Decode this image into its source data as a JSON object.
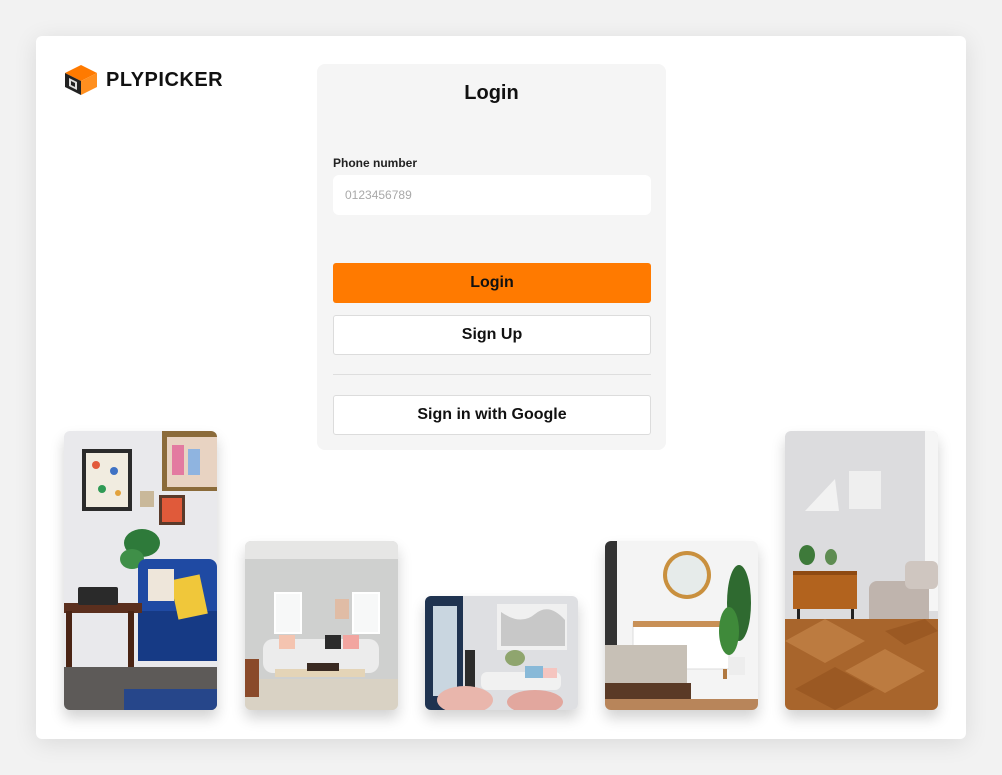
{
  "brand": {
    "name": "PLYPICKER",
    "logo_icon": "plypicker-cube-icon",
    "accent": "#ff7a00"
  },
  "login": {
    "title": "Login",
    "phone_label": "Phone number",
    "phone_placeholder": "0123456789",
    "phone_value": "",
    "login_button": "Login",
    "signup_button": "Sign Up",
    "google_button": "Sign in with Google"
  },
  "gallery": [
    {
      "name": "blue-sofa-living-room-photo"
    },
    {
      "name": "white-sofa-living-room-photo"
    },
    {
      "name": "pink-chairs-living-room-photo"
    },
    {
      "name": "bedroom-round-mirror-photo"
    },
    {
      "name": "wooden-floor-room-photo"
    }
  ]
}
